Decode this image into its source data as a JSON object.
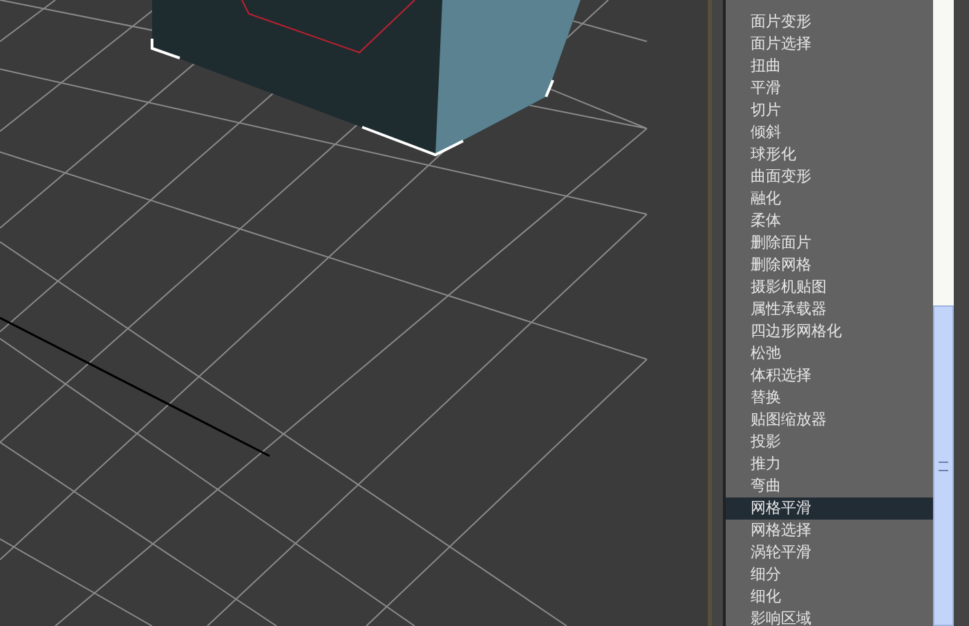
{
  "modifier_list": {
    "items": [
      {
        "label": "面片变形",
        "selected": false
      },
      {
        "label": "面片选择",
        "selected": false
      },
      {
        "label": "扭曲",
        "selected": false
      },
      {
        "label": "平滑",
        "selected": false
      },
      {
        "label": "切片",
        "selected": false
      },
      {
        "label": "倾斜",
        "selected": false
      },
      {
        "label": "球形化",
        "selected": false
      },
      {
        "label": "曲面变形",
        "selected": false
      },
      {
        "label": "融化",
        "selected": false
      },
      {
        "label": "柔体",
        "selected": false
      },
      {
        "label": "删除面片",
        "selected": false
      },
      {
        "label": "删除网格",
        "selected": false
      },
      {
        "label": "摄影机贴图",
        "selected": false
      },
      {
        "label": "属性承载器",
        "selected": false
      },
      {
        "label": "四边形网格化",
        "selected": false
      },
      {
        "label": "松弛",
        "selected": false
      },
      {
        "label": "体积选择",
        "selected": false
      },
      {
        "label": "替换",
        "selected": false
      },
      {
        "label": "贴图缩放器",
        "selected": false
      },
      {
        "label": "投影",
        "selected": false
      },
      {
        "label": "推力",
        "selected": false
      },
      {
        "label": "弯曲",
        "selected": false
      },
      {
        "label": "网格平滑",
        "selected": true
      },
      {
        "label": "网格选择",
        "selected": false
      },
      {
        "label": "涡轮平滑",
        "selected": false
      },
      {
        "label": "细分",
        "selected": false
      },
      {
        "label": "细化",
        "selected": false
      },
      {
        "label": "影响区域",
        "selected": false
      }
    ]
  }
}
